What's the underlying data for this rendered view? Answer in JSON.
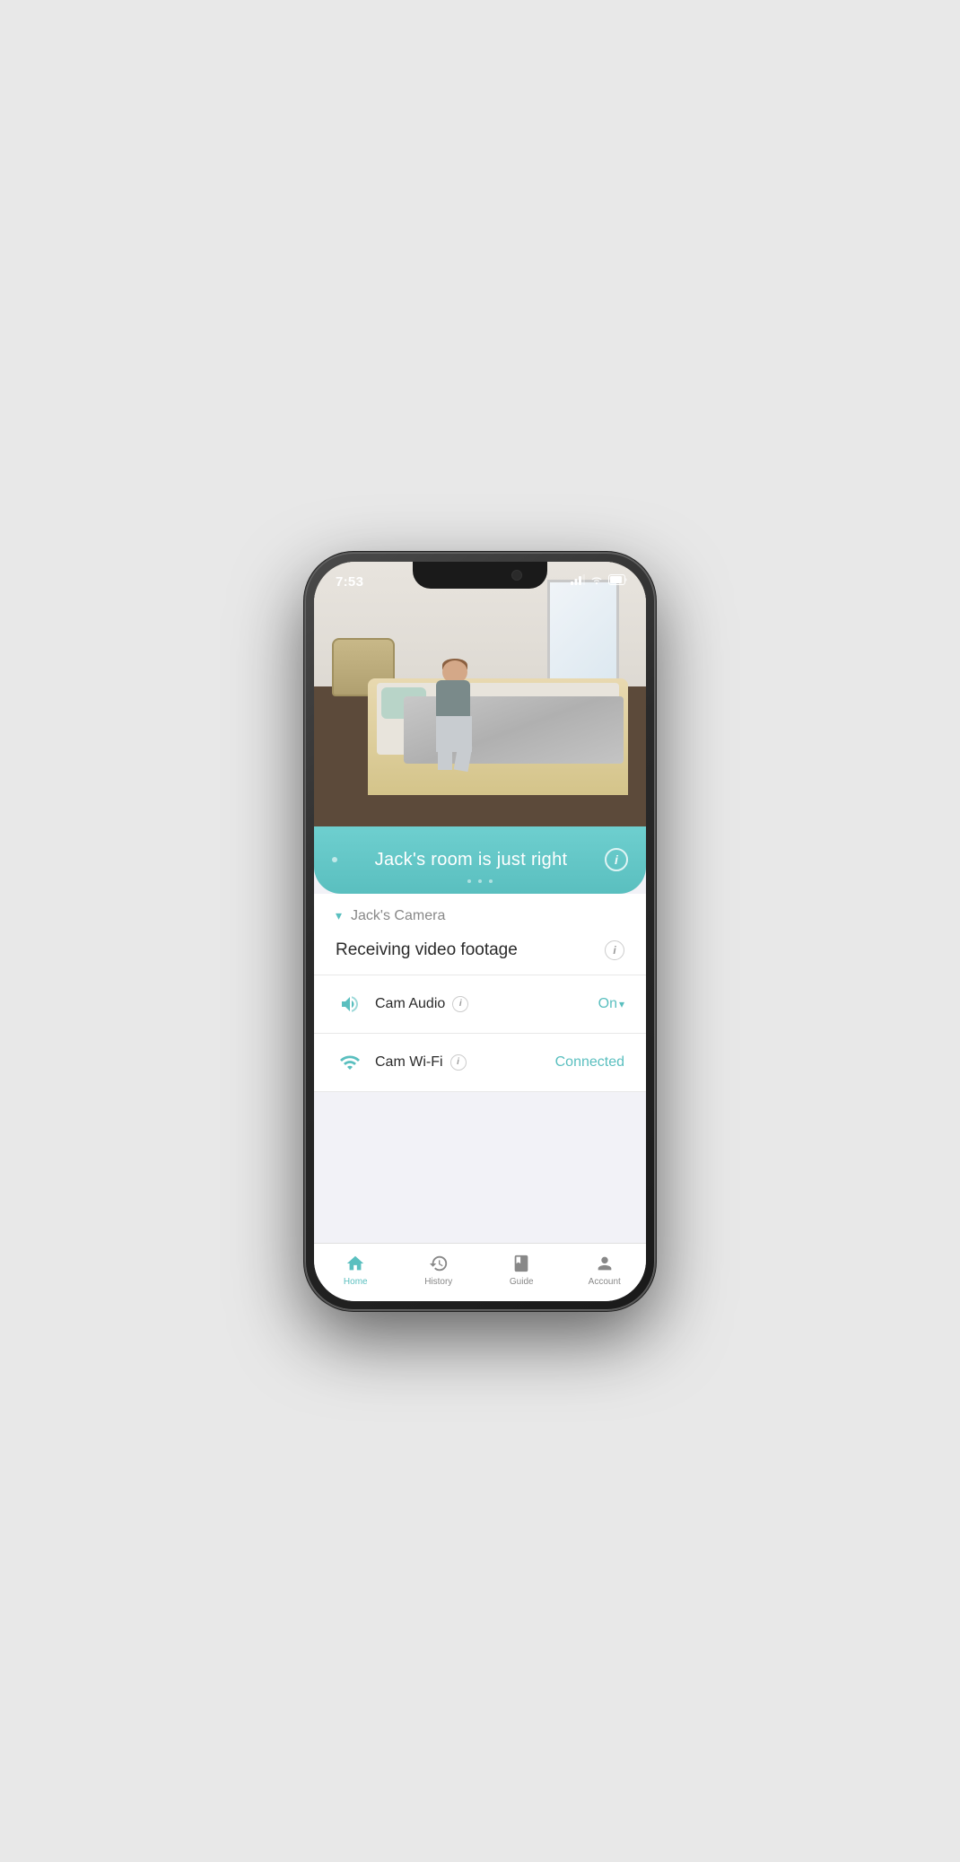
{
  "device": {
    "time": "7:53"
  },
  "banner": {
    "text": "Jack's room is just right",
    "info_label": "i"
  },
  "camera": {
    "name": "Jack's Camera",
    "status_text": "Receiving video footage",
    "audio_label": "Cam Audio",
    "audio_value": "On",
    "audio_arrow": "▾",
    "wifi_label": "Cam Wi-Fi",
    "wifi_value": "Connected",
    "info_label": "i"
  },
  "tabs": {
    "home_label": "Home",
    "history_label": "History",
    "guide_label": "Guide",
    "account_label": "Account"
  }
}
